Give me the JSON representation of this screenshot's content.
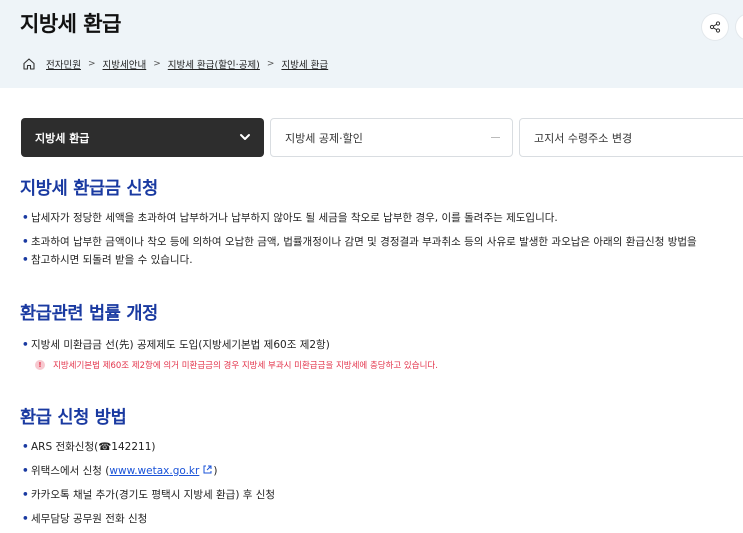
{
  "header": {
    "title": "지방세 환급",
    "share_icon": "share-icon"
  },
  "breadcrumb": {
    "items": [
      "전자민원",
      "지방세안내",
      "지방세 환급(할인·공제)",
      "지방세 환급"
    ],
    "separator": ">"
  },
  "tabs": [
    {
      "label": "지방세 환급",
      "active": true
    },
    {
      "label": "지방세 공제·할인",
      "active": false
    },
    {
      "label": "고지서 수령주소 변경",
      "active": false
    }
  ],
  "sections": {
    "refund_apply": {
      "heading": "지방세 환급금 신청",
      "bullets": [
        "납세자가 정당한 세액을 초과하여 납부하거나 납부하지 않아도 될 세금을 착오로 납부한 경우, 이를 돌려주는 제도입니다.",
        "초과하여 납부한 금액이나 착오 등에 의하여 오납한 금액, 법률개정이나 감면 및 경정결과 부과취소 등의 사유로 발생한 과오납은 아래의 환급신청 방법을",
        "참고하시면 되돌려 받을 수 있습니다."
      ]
    },
    "law_revision": {
      "heading": "환급관련 법률 개정",
      "bullet": "지방세 미환급금 선(先) 공제제도 도입(지방세기본법 제60조 제2항)",
      "warning": "지방세기본법 제60조 제2항에 의거 미환급금의 경우 지방세 부과시 미환급금을 지방세에 충당하고 있습니다."
    },
    "method": {
      "heading": "환급 신청 방법",
      "ars": "ARS 전화신청(☎142211)",
      "wetax_prefix": "위택스에서 신청 (",
      "wetax_link": "www.wetax.go.kr",
      "wetax_suffix": ")",
      "kakao": "카카오톡 채널 추가(경기도 평택시 지방세 환급) 후 신청",
      "officer": "세무담당 공무원 전화 신청"
    }
  },
  "colors": {
    "accent": "#1a3aa1",
    "warning": "#e3344b",
    "link": "#1a53d8",
    "header_bg": "#eef4f8",
    "active_tab": "#2d2d2d"
  }
}
